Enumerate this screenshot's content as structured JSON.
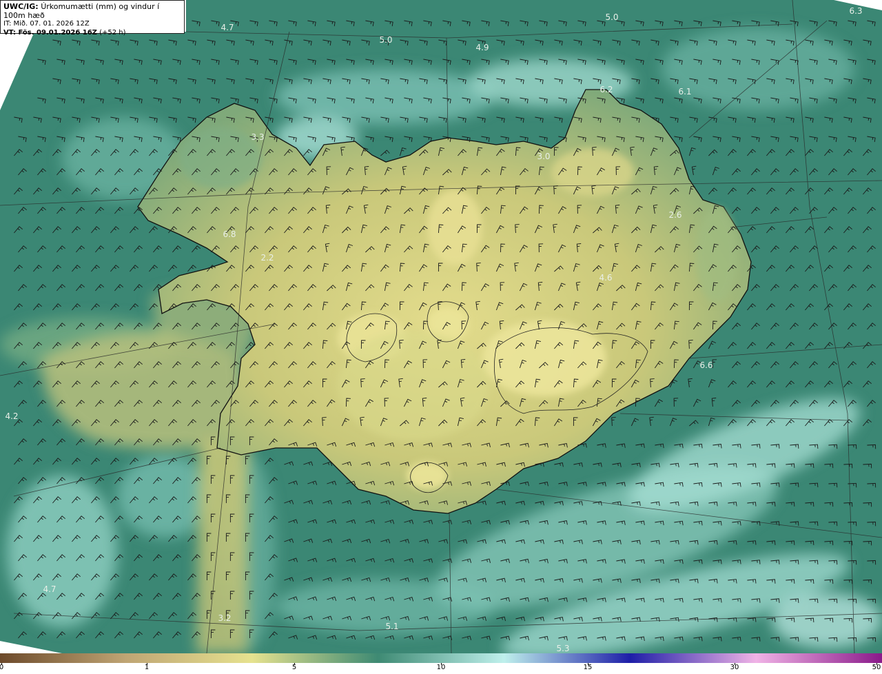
{
  "header": {
    "model": "UWC/IG:",
    "title": "Úrkomumætti (mm) og vindur í 100m hæð",
    "init_time": "IT: Mið. 07. 01. 2026 12Z",
    "valid_prefix": "VT: Fös. 09.01.2026 16Z",
    "valid_offset": "(+52 h)"
  },
  "max_labels": [
    "4.7",
    "5.0",
    "5.0",
    "4.9",
    "6.3",
    "3.3",
    "6.2",
    "6.1",
    "3.0",
    "2.6",
    "6.8",
    "2.2",
    "4.6",
    "6.6",
    "4.2",
    "4.7",
    "3.2",
    "5.1",
    "5.3"
  ],
  "colorbar": {
    "ticks": [
      "0",
      "1",
      "5",
      "10",
      "15",
      "30",
      "50"
    ],
    "colors": [
      "#6d4a2b",
      "#bfa574",
      "#e6e28f",
      "#3e8a73",
      "#bff0ec",
      "#1e1ea8",
      "#f0b3e6",
      "#8a1a8a"
    ]
  },
  "colors": {
    "sea": "#3b8774",
    "land": "#c9c77a",
    "land_high": "#e6df8f",
    "cloud": "#a5ddd3",
    "coast": "#111111"
  }
}
